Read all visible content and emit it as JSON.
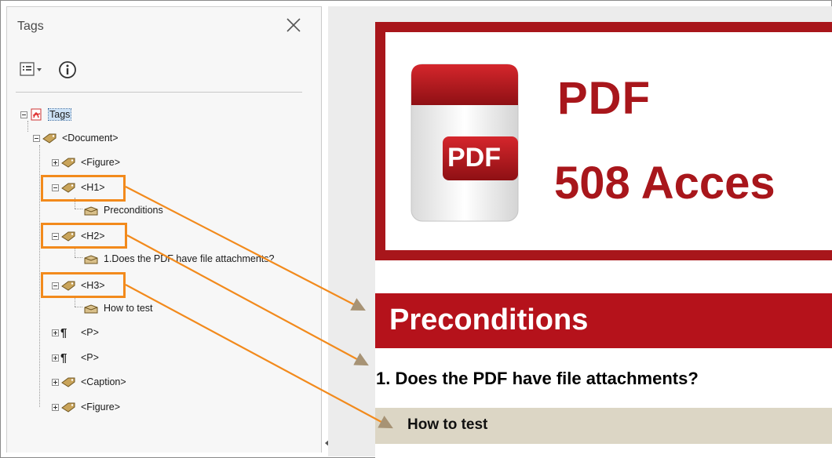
{
  "panel": {
    "title": "Tags",
    "tree": {
      "root": "Tags",
      "document": "<Document>",
      "figure1": "<Figure>",
      "h1": "<H1>",
      "h1_child": "Preconditions",
      "h2": "<H2>",
      "h2_child": "1.Does the PDF have file attachments?",
      "h3": "<H3>",
      "h3_child": "How to test",
      "p1": "<P>",
      "p2": "<P>",
      "caption": "<Caption>",
      "figure2": "<Figure>"
    }
  },
  "document": {
    "banner_line1": "PDF",
    "banner_line2": "508 Acces",
    "pdf_badge": "PDF",
    "h1": "Preconditions",
    "h2": "1. Does the PDF have file attachments?",
    "h3": "How to test"
  },
  "colors": {
    "highlight": "#f28a1c",
    "brand_red": "#a8161b",
    "h3_background": "#dcd6c5"
  }
}
